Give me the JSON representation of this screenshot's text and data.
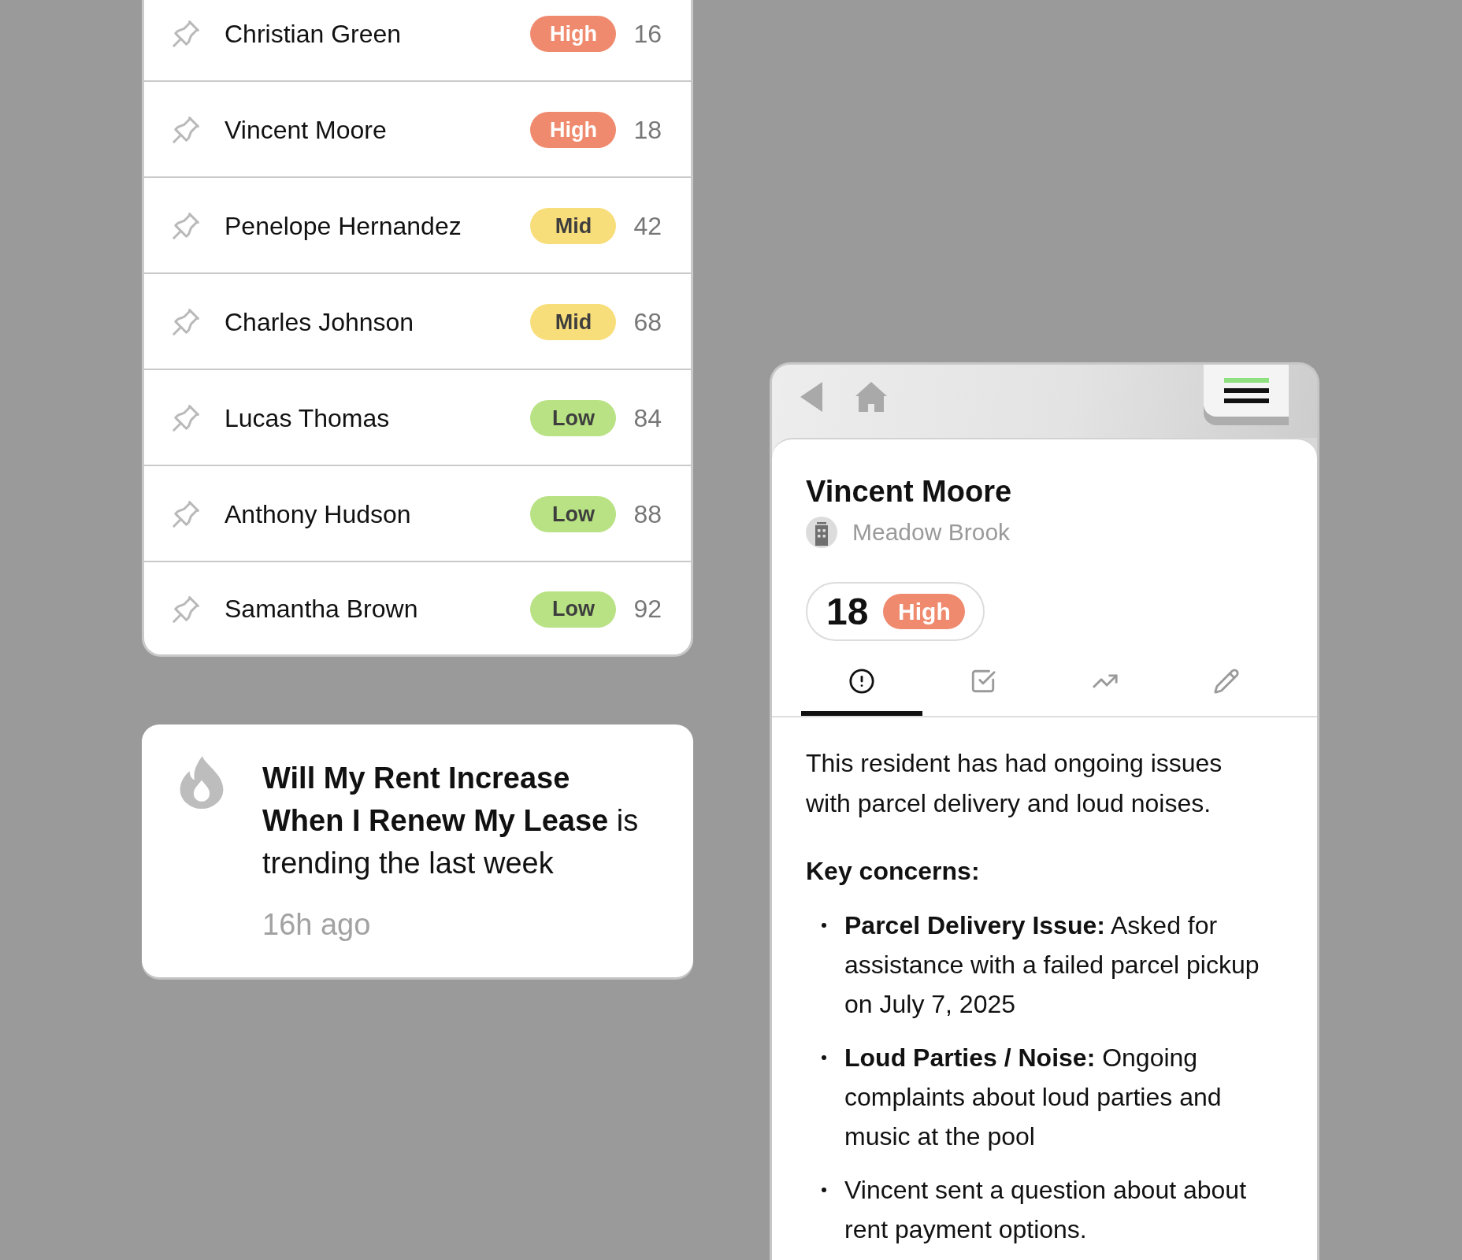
{
  "residents": [
    {
      "name": "Christian Green",
      "tag": "High",
      "color": "#ef8a6e",
      "score": "16"
    },
    {
      "name": "Vincent Moore",
      "tag": "High",
      "color": "#ef8a6e",
      "score": "18"
    },
    {
      "name": "Penelope Hernandez",
      "tag": "Mid",
      "color": "#f8de7a",
      "score": "42"
    },
    {
      "name": "Charles Johnson",
      "tag": "Mid",
      "color": "#f8de7a",
      "score": "68"
    },
    {
      "name": "Lucas Thomas",
      "tag": "Low",
      "color": "#b8e283",
      "score": "84"
    },
    {
      "name": "Anthony Hudson",
      "tag": "Low",
      "color": "#b8e283",
      "score": "88"
    },
    {
      "name": "Samantha Brown",
      "tag": "Low",
      "color": "#b8e283",
      "score": "92"
    }
  ],
  "trending": {
    "text": "**Will My Rent Increase When I Renew My Lease** is trending the last week",
    "time": "16h ago"
  },
  "detail": {
    "name": "Vincent Moore",
    "community": "Meadow Brook",
    "score": "18",
    "tag": "High",
    "color": "#ef8a6e",
    "tabs": [
      {
        "kind": "alert",
        "selected": true
      },
      {
        "kind": "tasks",
        "selected": false
      },
      {
        "kind": "trend",
        "selected": false
      },
      {
        "kind": "edit",
        "selected": false
      }
    ],
    "summary": "This resident has had ongoing issues with parcel delivery and loud noises.",
    "concerns_title": "Key concerns:",
    "concerns": [
      "**Parcel Delivery Issue:** Asked for assistance with a failed parcel pickup on July 7, 2025",
      "**Loud Parties / Noise:** Ongoing complaints about loud parties and music at the pool",
      "Vincent sent a question about about rent payment options."
    ]
  }
}
